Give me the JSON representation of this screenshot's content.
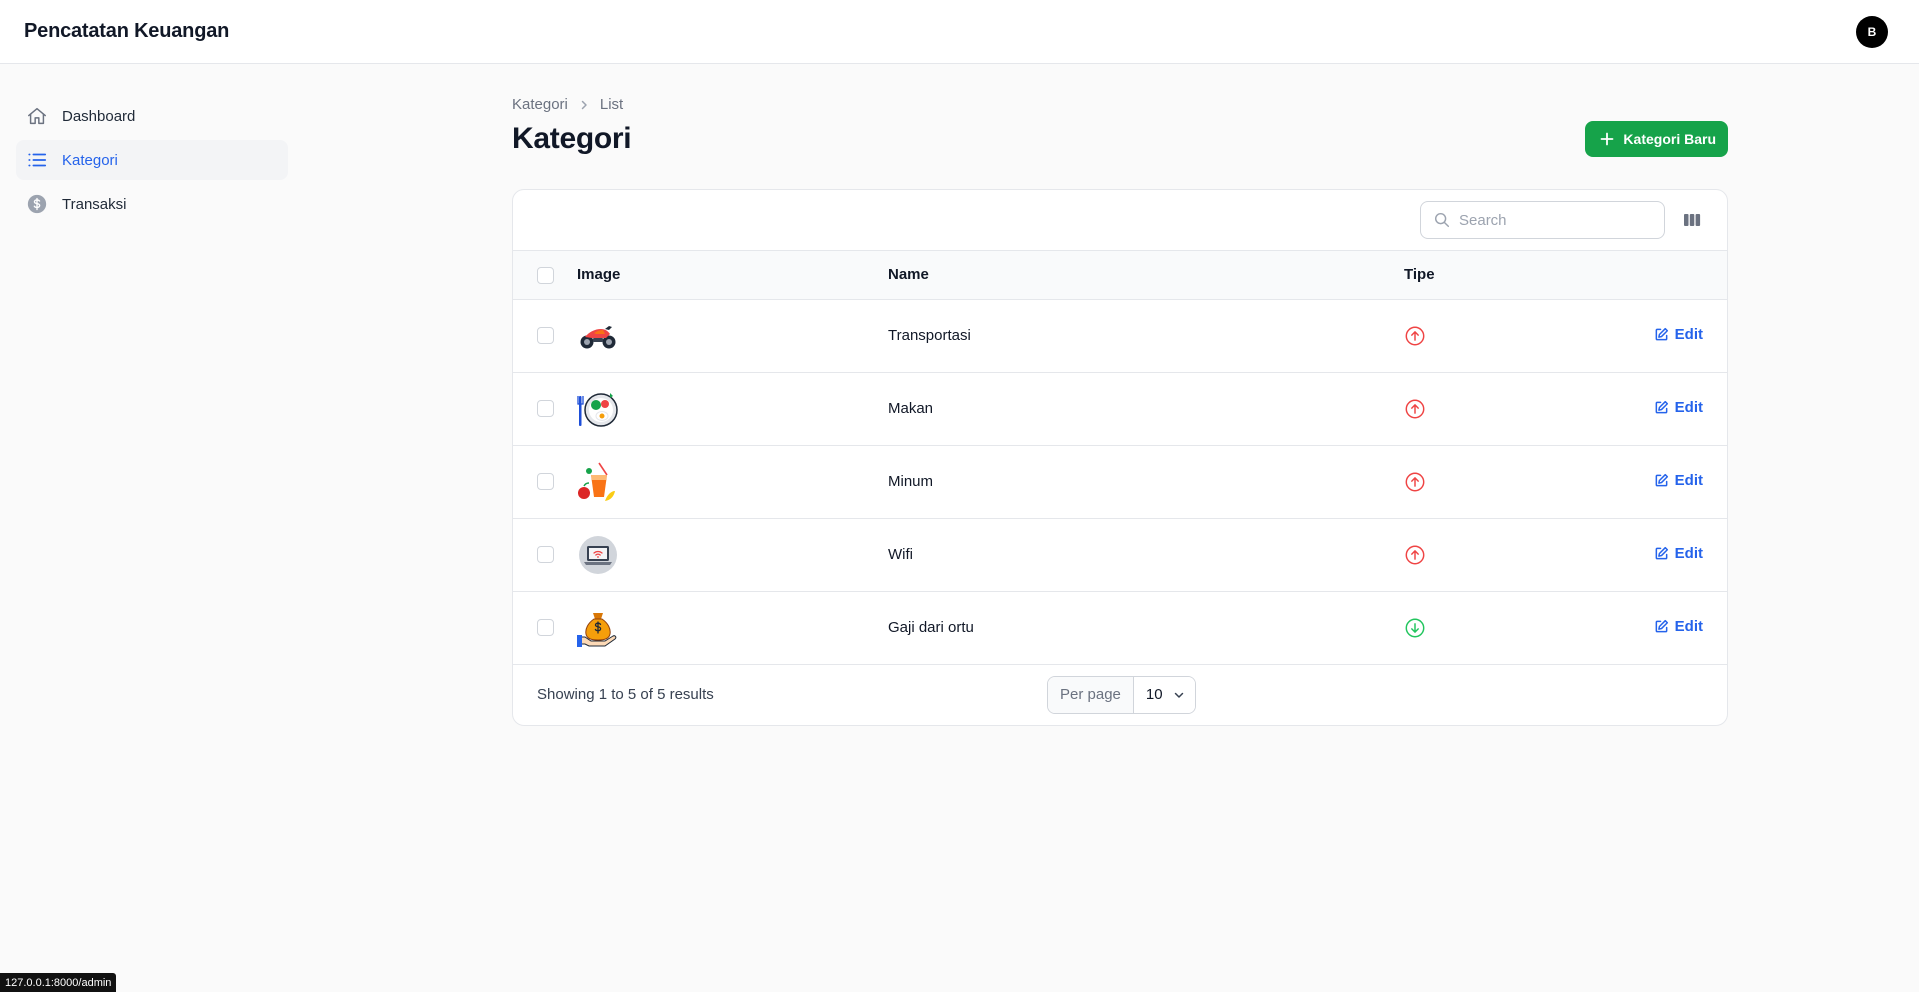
{
  "app": {
    "title": "Pencatatan Keuangan",
    "user_initial": "B"
  },
  "sidebar": {
    "items": [
      {
        "label": "Dashboard",
        "icon": "home-icon",
        "active": false
      },
      {
        "label": "Kategori",
        "icon": "list-icon",
        "active": true
      },
      {
        "label": "Transaksi",
        "icon": "dollar-circle-icon",
        "active": false
      }
    ]
  },
  "breadcrumb": {
    "items": [
      "Kategori",
      "List"
    ]
  },
  "page": {
    "title": "Kategori",
    "new_button_label": "Kategori Baru"
  },
  "table": {
    "search_placeholder": "Search",
    "columns": {
      "image": "Image",
      "name": "Name",
      "tipe": "Tipe"
    },
    "edit_label": "Edit",
    "rows": [
      {
        "image": "motorcycle-icon",
        "name": "Transportasi",
        "tipe": "arrow-up-circle-icon",
        "tipe_color": "#ef4444"
      },
      {
        "image": "food-plate-icon",
        "name": "Makan",
        "tipe": "arrow-up-circle-icon",
        "tipe_color": "#ef4444"
      },
      {
        "image": "drinks-icon",
        "name": "Minum",
        "tipe": "arrow-up-circle-icon",
        "tipe_color": "#ef4444"
      },
      {
        "image": "wifi-laptop-icon",
        "name": "Wifi",
        "tipe": "arrow-up-circle-icon",
        "tipe_color": "#ef4444"
      },
      {
        "image": "money-bag-icon",
        "name": "Gaji dari ortu",
        "tipe": "arrow-down-circle-icon",
        "tipe_color": "#22c55e"
      }
    ],
    "footer": {
      "showing": "Showing 1 to 5 of 5 results",
      "per_page_label": "Per page",
      "per_page_value": "10"
    }
  },
  "status_bar": {
    "url": "127.0.0.1:8000/admin"
  },
  "colors": {
    "primary": "#16a34a",
    "link": "#2563eb",
    "expense": "#ef4444",
    "income": "#22c55e"
  }
}
